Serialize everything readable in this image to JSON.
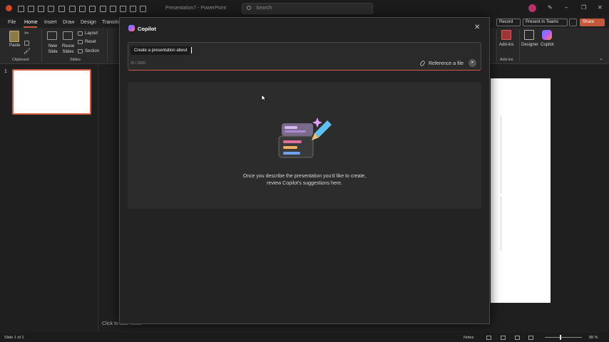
{
  "titlebar": {
    "document_title": "Presentation7  -  PowerPoint",
    "search_placeholder": "Search",
    "minimize": "–",
    "restore": "❐",
    "close": "✕"
  },
  "ribbon_tabs": [
    "File",
    "Home",
    "Insert",
    "Draw",
    "Design",
    "Transitio"
  ],
  "ribbon_right": {
    "record": "Record",
    "present_in_teams": "Present in Teams",
    "share": "Share"
  },
  "ribbon": {
    "paste": "Paste",
    "clipboard_group": "Clipboard",
    "new_slide": "New Slide",
    "reuse_slides": "Reuse Slides",
    "layout": "Layout",
    "reset": "Reset",
    "section": "Section",
    "slides_group": "Slides",
    "add_ins": "Add-ins",
    "designer": "Designer",
    "copilot": "Copilot",
    "add_ins_group": "Add-ins"
  },
  "thumbnail": {
    "number": "1"
  },
  "notes_placeholder": "Click to add notes",
  "statusbar": {
    "slide_counter": "Slide 1 of 1",
    "notes": "Notes",
    "zoom": "88 %"
  },
  "copilot_dialog": {
    "title": "Copilot",
    "prompt_chip": "Create a presentation about",
    "char_count": "26 / 2000",
    "reference_file": "Reference a file",
    "empty_message_line1": "Once you describe the presentation you'd like to create,",
    "empty_message_line2": "review Copilot's suggestions here."
  },
  "colors": {
    "accent": "#c4583a",
    "dialog_bg": "#232323",
    "panel_bg": "#2c2c2c",
    "app_bg": "#1f1f1f"
  }
}
